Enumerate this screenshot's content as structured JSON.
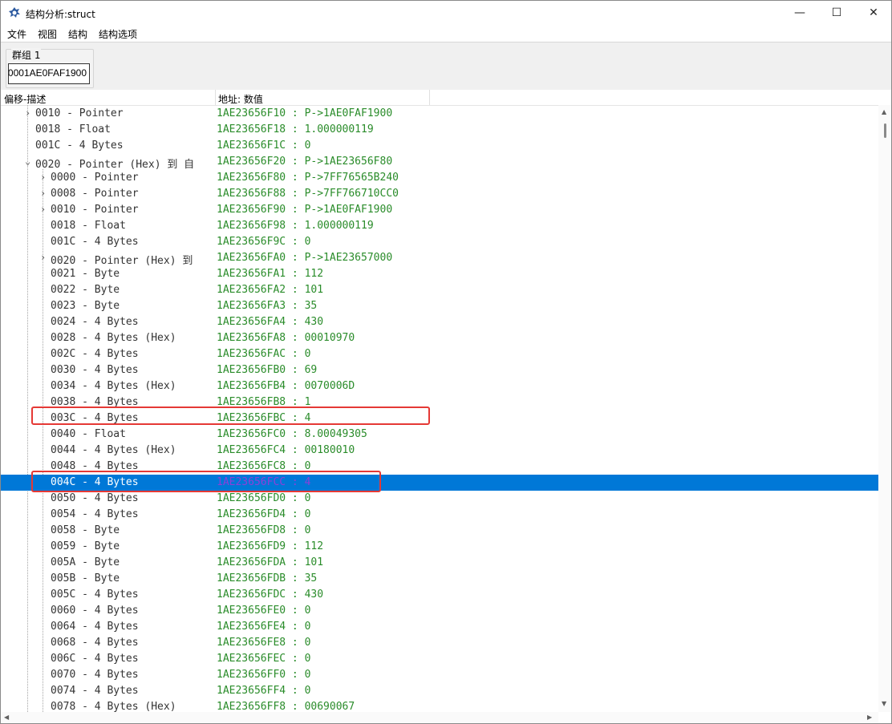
{
  "window": {
    "title": "结构分析:struct",
    "minimize": "—",
    "maximize": "☐",
    "close": "✕"
  },
  "menu": [
    "文件",
    "视图",
    "结构",
    "结构选项"
  ],
  "group": {
    "label": "群组 1",
    "address": "00001AE0FAF1900"
  },
  "columns": {
    "desc": "偏移-描述",
    "value": "地址: 数值"
  },
  "colors": {
    "value_text": "#2a8c2a",
    "selection": "#0078d7",
    "highlight_box": "#e53935"
  },
  "rows": [
    {
      "desc": "0010 - Pointer",
      "value": "1AE23656F10 : P->1AE0FAF1900",
      "expander": "›",
      "level": 1
    },
    {
      "desc": "0018 - Float",
      "value": "1AE23656F18 : 1.000000119",
      "expander": "",
      "level": 1
    },
    {
      "desc": "001C - 4 Bytes",
      "value": "1AE23656F1C : 0",
      "expander": "",
      "level": 1
    },
    {
      "desc": "0020 - Pointer (Hex) 到 自",
      "value": "1AE23656F20 : P->1AE23656F80",
      "expander": "⌄",
      "level": 1
    },
    {
      "desc": "0000 - Pointer",
      "value": "1AE23656F80 : P->7FF76565B240",
      "expander": "›",
      "level": 2
    },
    {
      "desc": "0008 - Pointer",
      "value": "1AE23656F88 : P->7FF766710CC0",
      "expander": "›",
      "level": 2
    },
    {
      "desc": "0010 - Pointer",
      "value": "1AE23656F90 : P->1AE0FAF1900",
      "expander": "›",
      "level": 2
    },
    {
      "desc": "0018 - Float",
      "value": "1AE23656F98 : 1.000000119",
      "expander": "",
      "level": 2
    },
    {
      "desc": "001C - 4 Bytes",
      "value": "1AE23656F9C : 0",
      "expander": "",
      "level": 2
    },
    {
      "desc": "0020 - Pointer (Hex) 到",
      "value": "1AE23656FA0 : P->1AE23657000",
      "expander": "›",
      "level": 2
    },
    {
      "desc": "0021 - Byte",
      "value": "1AE23656FA1 : 112",
      "expander": "",
      "level": 2
    },
    {
      "desc": "0022 - Byte",
      "value": "1AE23656FA2 : 101",
      "expander": "",
      "level": 2
    },
    {
      "desc": "0023 - Byte",
      "value": "1AE23656FA3 : 35",
      "expander": "",
      "level": 2
    },
    {
      "desc": "0024 - 4 Bytes",
      "value": "1AE23656FA4 : 430",
      "expander": "",
      "level": 2
    },
    {
      "desc": "0028 - 4 Bytes (Hex)",
      "value": "1AE23656FA8 : 00010970",
      "expander": "",
      "level": 2
    },
    {
      "desc": "002C - 4 Bytes",
      "value": "1AE23656FAC : 0",
      "expander": "",
      "level": 2
    },
    {
      "desc": "0030 - 4 Bytes",
      "value": "1AE23656FB0 : 69",
      "expander": "",
      "level": 2
    },
    {
      "desc": "0034 - 4 Bytes (Hex)",
      "value": "1AE23656FB4 : 0070006D",
      "expander": "",
      "level": 2
    },
    {
      "desc": "0038 - 4 Bytes",
      "value": "1AE23656FB8 : 1",
      "expander": "",
      "level": 2
    },
    {
      "desc": "003C - 4 Bytes",
      "value": "1AE23656FBC : 4",
      "expander": "",
      "level": 2
    },
    {
      "desc": "0040 - Float",
      "value": "1AE23656FC0 : 8.00049305",
      "expander": "",
      "level": 2
    },
    {
      "desc": "0044 - 4 Bytes (Hex)",
      "value": "1AE23656FC4 : 00180010",
      "expander": "",
      "level": 2
    },
    {
      "desc": "0048 - 4 Bytes",
      "value": "1AE23656FC8 : 0",
      "expander": "",
      "level": 2
    },
    {
      "desc": "004C - 4 Bytes",
      "value": "1AE23656FCC : 4",
      "expander": "",
      "level": 2,
      "selected": true
    },
    {
      "desc": "0050 - 4 Bytes",
      "value": "1AE23656FD0 : 0",
      "expander": "",
      "level": 2
    },
    {
      "desc": "0054 - 4 Bytes",
      "value": "1AE23656FD4 : 0",
      "expander": "",
      "level": 2
    },
    {
      "desc": "0058 - Byte",
      "value": "1AE23656FD8 : 0",
      "expander": "",
      "level": 2
    },
    {
      "desc": "0059 - Byte",
      "value": "1AE23656FD9 : 112",
      "expander": "",
      "level": 2
    },
    {
      "desc": "005A - Byte",
      "value": "1AE23656FDA : 101",
      "expander": "",
      "level": 2
    },
    {
      "desc": "005B - Byte",
      "value": "1AE23656FDB : 35",
      "expander": "",
      "level": 2
    },
    {
      "desc": "005C - 4 Bytes",
      "value": "1AE23656FDC : 430",
      "expander": "",
      "level": 2
    },
    {
      "desc": "0060 - 4 Bytes",
      "value": "1AE23656FE0 : 0",
      "expander": "",
      "level": 2
    },
    {
      "desc": "0064 - 4 Bytes",
      "value": "1AE23656FE4 : 0",
      "expander": "",
      "level": 2
    },
    {
      "desc": "0068 - 4 Bytes",
      "value": "1AE23656FE8 : 0",
      "expander": "",
      "level": 2
    },
    {
      "desc": "006C - 4 Bytes",
      "value": "1AE23656FEC : 0",
      "expander": "",
      "level": 2
    },
    {
      "desc": "0070 - 4 Bytes",
      "value": "1AE23656FF0 : 0",
      "expander": "",
      "level": 2
    },
    {
      "desc": "0074 - 4 Bytes",
      "value": "1AE23656FF4 : 0",
      "expander": "",
      "level": 2
    },
    {
      "desc": "0078 - 4 Bytes (Hex)",
      "value": "1AE23656FF8 : 00690067",
      "expander": "",
      "level": 2
    }
  ]
}
